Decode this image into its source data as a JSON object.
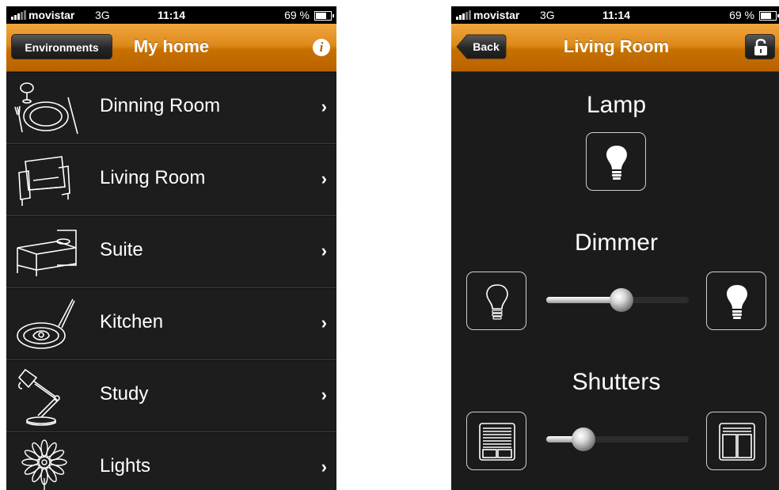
{
  "left_screen": {
    "status": {
      "carrier": "movistar",
      "network": "3G",
      "time": "11:14",
      "battery": "69 %"
    },
    "nav": {
      "title": "My home",
      "left_button": "Environments",
      "right_icon": "info-icon"
    },
    "rooms": [
      {
        "label": "Dinning Room",
        "icon": "dining-plate-icon"
      },
      {
        "label": "Living Room",
        "icon": "armchair-icon"
      },
      {
        "label": "Suite",
        "icon": "bed-icon"
      },
      {
        "label": "Kitchen",
        "icon": "frying-pan-icon"
      },
      {
        "label": "Study",
        "icon": "desk-lamp-icon"
      },
      {
        "label": "Lights",
        "icon": "flower-icon"
      }
    ],
    "chevron": "›"
  },
  "right_screen": {
    "status": {
      "carrier": "movistar",
      "network": "3G",
      "time": "11:14",
      "battery": "69 %"
    },
    "nav": {
      "title": "Living Room",
      "left_button": "Back",
      "right_icon": "lock-icon"
    },
    "sections": {
      "lamp": {
        "label": "Lamp",
        "icon": "lightbulb-icon"
      },
      "dimmer": {
        "label": "Dimmer",
        "level": 0.53,
        "min_icon": "lightbulb-off-icon",
        "max_icon": "lightbulb-on-icon"
      },
      "shutters": {
        "label": "Shutters",
        "level": 0.26,
        "min_icon": "shutter-closed-icon",
        "max_icon": "shutter-open-icon"
      }
    }
  },
  "colors": {
    "nav_orange": "#dd8a1a",
    "background": "#1b1b1b",
    "text": "#ffffff"
  }
}
